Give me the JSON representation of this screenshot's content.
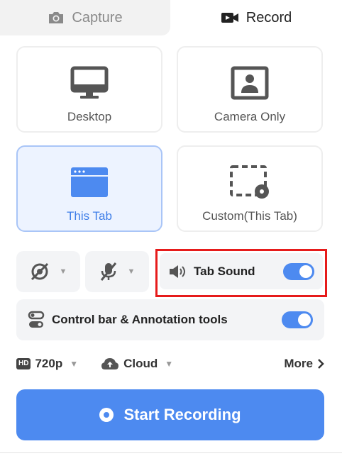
{
  "tabs": {
    "capture_label": "Capture",
    "record_label": "Record",
    "active": "record"
  },
  "sources": [
    {
      "label": "Desktop",
      "icon": "monitor-icon",
      "selected": false
    },
    {
      "label": "Camera Only",
      "icon": "camera-portrait-icon",
      "selected": false
    },
    {
      "label": "This Tab",
      "icon": "browser-window-icon",
      "selected": true
    },
    {
      "label": "Custom(This Tab)",
      "icon": "custom-area-icon",
      "selected": false
    }
  ],
  "controls": {
    "camera_icon": "camera-off-icon",
    "mic_icon": "mic-off-icon",
    "tab_sound_label": "Tab Sound",
    "tab_sound_on": true,
    "control_bar_label": "Control bar & Annotation tools",
    "control_bar_on": true
  },
  "options": {
    "hd_badge": "HD",
    "resolution": "720p",
    "storage": "Cloud",
    "more_label": "More"
  },
  "start_button_label": "Start Recording",
  "colors": {
    "accent": "#4d8af0",
    "selected_bg": "#edf3ff",
    "highlight_border": "#e61b1b",
    "panel_bg": "#f3f4f6"
  }
}
